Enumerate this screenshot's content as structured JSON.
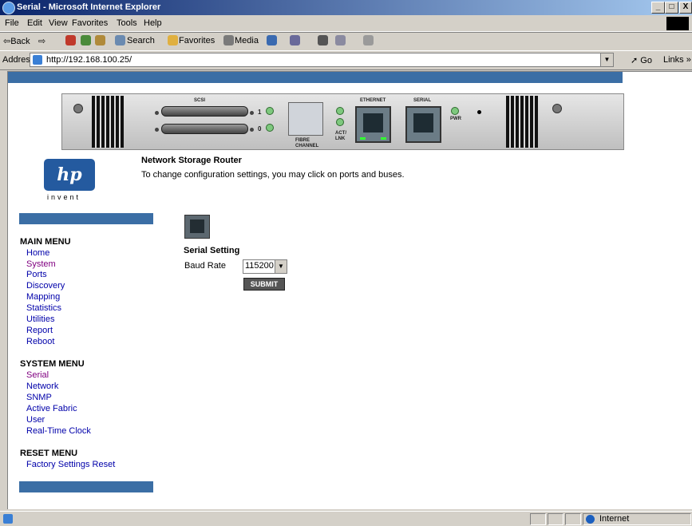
{
  "window": {
    "title": "Serial - Microsoft Internet Explorer",
    "minimize": "_",
    "maximize": "□",
    "close": "X"
  },
  "menubar": [
    "File",
    "Edit",
    "View",
    "Favorites",
    "Tools",
    "Help"
  ],
  "toolbar": {
    "back": "⇦Back",
    "forward": "⇨",
    "search": "Search",
    "favorites": "Favorites",
    "media": "Media"
  },
  "addressbar": {
    "label": "Address",
    "url": "http://192.168.100.25/",
    "go": "Go",
    "links": "Links"
  },
  "device": {
    "labels": {
      "scsi": "SCSI",
      "fibre_channel": "FIBRE CHANNEL",
      "act_lnk": "ACT/ LNK",
      "ethernet": "ETHERNET",
      "serial": "SERIAL",
      "pwr": "PWR",
      "bus1": "1",
      "bus0": "0"
    }
  },
  "logo": {
    "mark": "hp",
    "tagline": "invent"
  },
  "page": {
    "heading": "Network Storage Router",
    "description": "To change configuration settings, you may click on ports and buses."
  },
  "main_menu": {
    "title": "MAIN MENU",
    "items": [
      "Home",
      "System",
      "Ports",
      "Discovery",
      "Mapping",
      "Statistics",
      "Utilities",
      "Report",
      "Reboot"
    ]
  },
  "system_menu": {
    "title": "SYSTEM MENU",
    "items": [
      "Serial",
      "Network",
      "SNMP",
      "Active Fabric",
      "User",
      "Real-Time Clock"
    ]
  },
  "reset_menu": {
    "title": "RESET MENU",
    "items": [
      "Factory Settings Reset"
    ]
  },
  "serial_setting": {
    "title": "Serial Setting",
    "baud_label": "Baud Rate",
    "baud_value": "115200",
    "submit_label": "SUBMIT"
  },
  "statusbar": {
    "zone": "Internet"
  },
  "colors": {
    "titlebar": "#0a246a",
    "blue_bar": "#3b6ea5",
    "link": "#0000aa",
    "visited_link": "#800080"
  }
}
